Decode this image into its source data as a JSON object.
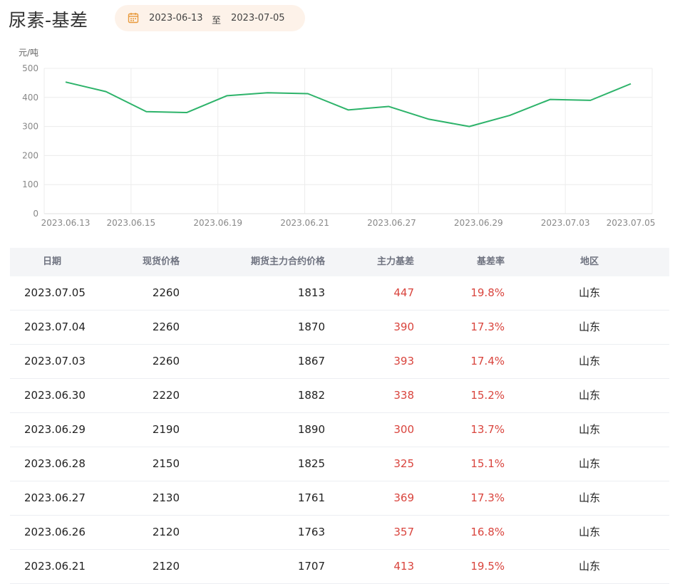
{
  "header": {
    "title": "尿素-基差",
    "date_start": "2023-06-13",
    "date_sep": "至",
    "date_end": "2023-07-05"
  },
  "chart_data": {
    "type": "line",
    "ylabel": "元/吨",
    "ylim": [
      0,
      500
    ],
    "yticks": [
      0,
      100,
      200,
      300,
      400,
      500
    ],
    "xtick_labels": [
      "2023.06.13",
      "2023.06.15",
      "2023.06.19",
      "2023.06.21",
      "2023.06.27",
      "2023.06.29",
      "2023.07.03",
      "2023.07.05"
    ],
    "x": [
      "2023.06.13",
      "2023.06.14",
      "2023.06.15",
      "2023.06.16",
      "2023.06.19",
      "2023.06.20",
      "2023.06.21",
      "2023.06.26",
      "2023.06.27",
      "2023.06.28",
      "2023.06.29",
      "2023.06.30",
      "2023.07.03",
      "2023.07.04",
      "2023.07.05"
    ],
    "values": [
      453,
      420,
      351,
      348,
      406,
      416,
      413,
      357,
      369,
      325,
      300,
      338,
      393,
      390,
      447
    ],
    "color": "#2db36a",
    "grid": true
  },
  "table": {
    "headers": {
      "date": "日期",
      "spot": "现货价格",
      "futures": "期货主力合约价格",
      "basis": "主力基差",
      "rate": "基差率",
      "region": "地区"
    },
    "rows": [
      {
        "date": "2023.07.05",
        "spot": "2260",
        "futures": "1813",
        "basis": "447",
        "rate": "19.8%",
        "region": "山东"
      },
      {
        "date": "2023.07.04",
        "spot": "2260",
        "futures": "1870",
        "basis": "390",
        "rate": "17.3%",
        "region": "山东"
      },
      {
        "date": "2023.07.03",
        "spot": "2260",
        "futures": "1867",
        "basis": "393",
        "rate": "17.4%",
        "region": "山东"
      },
      {
        "date": "2023.06.30",
        "spot": "2220",
        "futures": "1882",
        "basis": "338",
        "rate": "15.2%",
        "region": "山东"
      },
      {
        "date": "2023.06.29",
        "spot": "2190",
        "futures": "1890",
        "basis": "300",
        "rate": "13.7%",
        "region": "山东"
      },
      {
        "date": "2023.06.28",
        "spot": "2150",
        "futures": "1825",
        "basis": "325",
        "rate": "15.1%",
        "region": "山东"
      },
      {
        "date": "2023.06.27",
        "spot": "2130",
        "futures": "1761",
        "basis": "369",
        "rate": "17.3%",
        "region": "山东"
      },
      {
        "date": "2023.06.26",
        "spot": "2120",
        "futures": "1763",
        "basis": "357",
        "rate": "16.8%",
        "region": "山东"
      },
      {
        "date": "2023.06.21",
        "spot": "2120",
        "futures": "1707",
        "basis": "413",
        "rate": "19.5%",
        "region": "山东"
      }
    ]
  }
}
